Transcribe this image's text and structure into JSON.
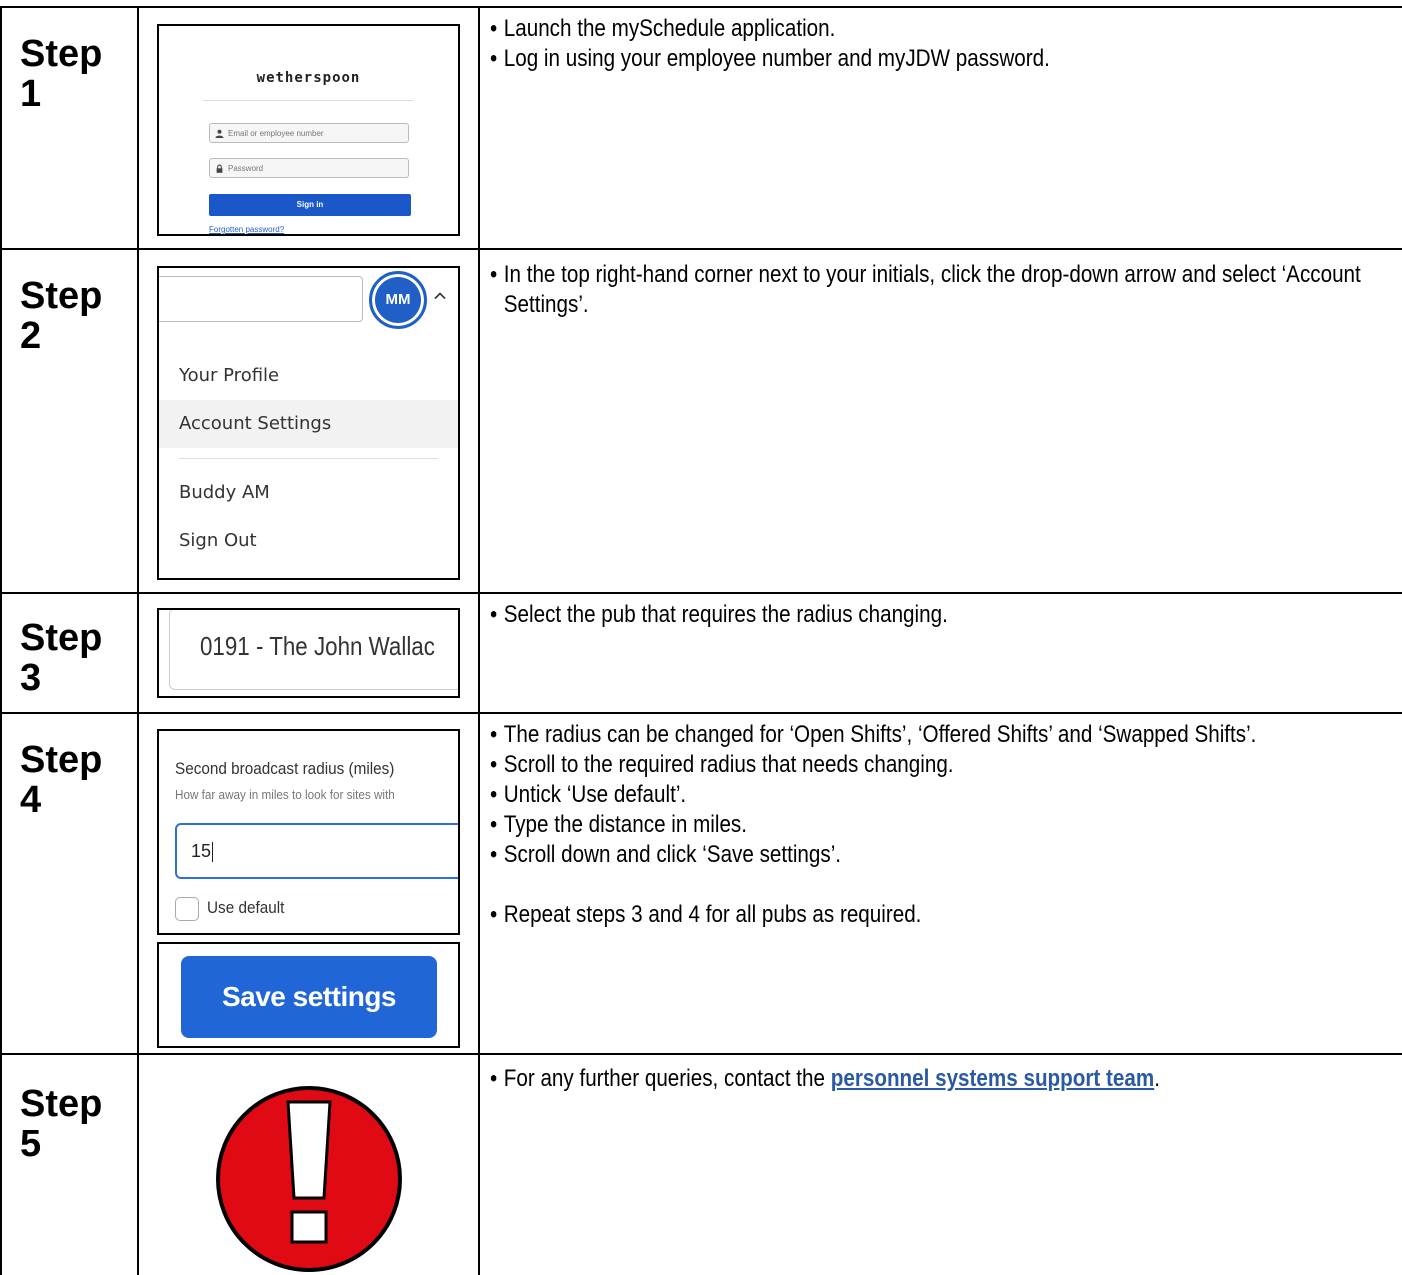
{
  "steps": [
    {
      "label": "Step 1"
    },
    {
      "label": "Step 2"
    },
    {
      "label": "Step 3"
    },
    {
      "label": "Step 4"
    },
    {
      "label": "Step 5"
    }
  ],
  "step1": {
    "brand": "wetherspoon",
    "email_placeholder": "Email or employee number",
    "password_placeholder": "Password",
    "signin_label": "Sign in",
    "forgot_link": "Forgotten password?",
    "bullets": [
      "Launch the mySchedule application.",
      "Log in using your employee number and myJDW password."
    ]
  },
  "step2": {
    "initials": "MM",
    "menu_items": [
      "Your Profile",
      "Account Settings",
      "Buddy AM",
      "Sign Out"
    ],
    "bullets": [
      "In the top right-hand corner next to your initials, click the drop-down arrow and select ‘Account Settings’."
    ]
  },
  "step3": {
    "pub_value": "0191 - The John Wallac",
    "bullets": [
      "Select the pub that requires the radius changing."
    ]
  },
  "step4": {
    "radius_title": "Second broadcast radius (miles)",
    "radius_help": "How far away in miles to look for sites with",
    "radius_value": "15",
    "use_default_label": "Use default",
    "save_label": "Save settings",
    "bullets": [
      "The radius can be changed for ‘Open Shifts’, ‘Offered Shifts’ and ‘Swapped Shifts’.",
      "Scroll to the required radius that needs changing.",
      "Untick ‘Use default’.",
      "Type the distance in miles.",
      "Scroll down and click ‘Save settings’."
    ],
    "repeat_bullet": "Repeat steps 3 and 4 for all pubs as required."
  },
  "step5": {
    "text_before": "For any further queries, contact the ",
    "link_text": "personnel systems support team",
    "text_after": ".",
    "warning_color": "#e00a14"
  }
}
